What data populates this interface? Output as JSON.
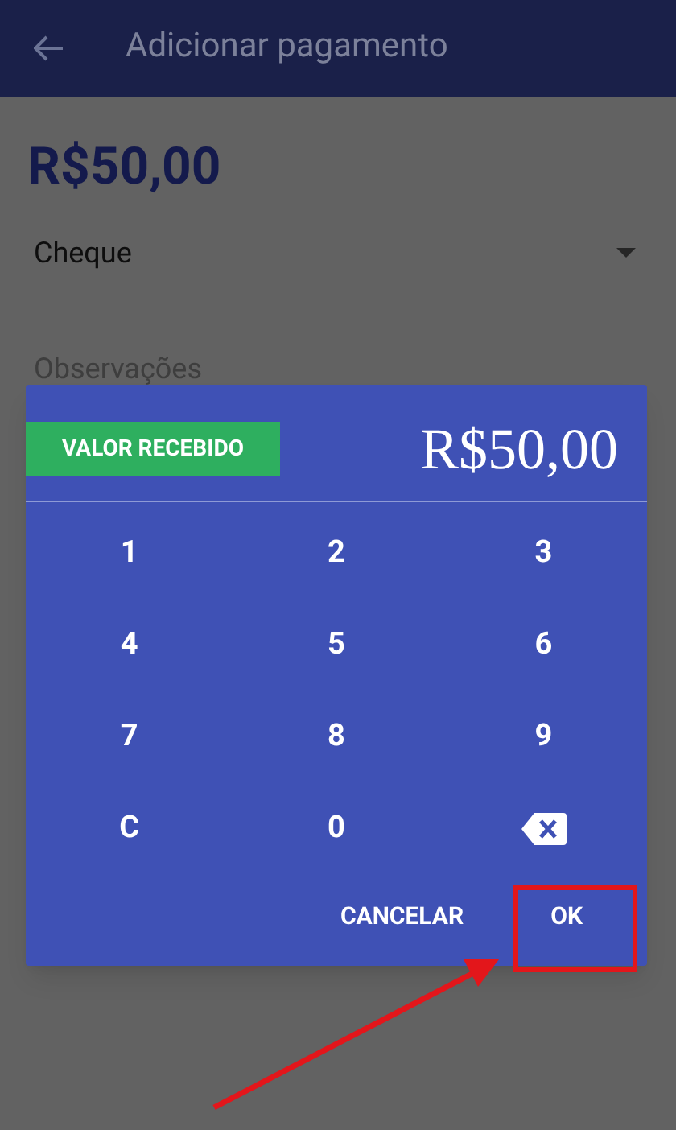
{
  "app_bar": {
    "title": "Adicionar pagamento"
  },
  "amount": "R$50,00",
  "payment_method": {
    "value": "Cheque"
  },
  "notes": {
    "placeholder": "Observações"
  },
  "dialog": {
    "tag": "VALOR RECEBIDO",
    "value": "R$50,00",
    "keys": [
      {
        "kind": "text",
        "label": "1"
      },
      {
        "kind": "text",
        "label": "2"
      },
      {
        "kind": "text",
        "label": "3"
      },
      {
        "kind": "text",
        "label": "4"
      },
      {
        "kind": "text",
        "label": "5"
      },
      {
        "kind": "text",
        "label": "6"
      },
      {
        "kind": "text",
        "label": "7"
      },
      {
        "kind": "text",
        "label": "8"
      },
      {
        "kind": "text",
        "label": "9"
      },
      {
        "kind": "text",
        "label": "C"
      },
      {
        "kind": "text",
        "label": "0"
      },
      {
        "kind": "backspace"
      }
    ],
    "buttons": [
      "CANCELAR",
      "OK"
    ]
  },
  "annotations": {
    "highlight_frame": true,
    "arrow": true
  }
}
